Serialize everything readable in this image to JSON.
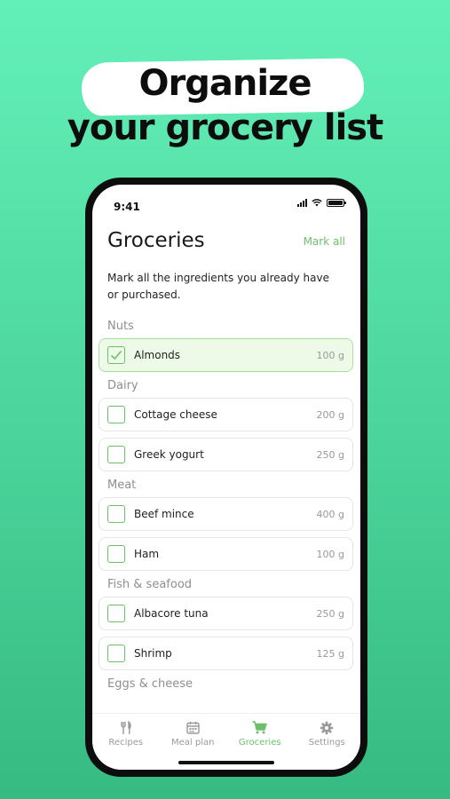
{
  "headline": {
    "line1": "Organize",
    "line2": "your grocery list"
  },
  "status_bar": {
    "time": "9:41"
  },
  "header": {
    "title": "Groceries",
    "mark_all": "Mark all"
  },
  "subtitle": "Mark all the ingredients you already have or purchased.",
  "sections": [
    {
      "title": "Nuts",
      "items": [
        {
          "name": "Almonds",
          "qty": "100 g",
          "checked": true
        }
      ]
    },
    {
      "title": "Dairy",
      "items": [
        {
          "name": "Cottage cheese",
          "qty": "200 g",
          "checked": false
        },
        {
          "name": "Greek yogurt",
          "qty": "250 g",
          "checked": false
        }
      ]
    },
    {
      "title": "Meat",
      "items": [
        {
          "name": "Beef mince",
          "qty": "400 g",
          "checked": false
        },
        {
          "name": "Ham",
          "qty": "100 g",
          "checked": false
        }
      ]
    },
    {
      "title": "Fish & seafood",
      "items": [
        {
          "name": "Albacore tuna",
          "qty": "250 g",
          "checked": false
        },
        {
          "name": "Shrimp",
          "qty": "125 g",
          "checked": false
        }
      ]
    },
    {
      "title": "Eggs & cheese",
      "items": []
    }
  ],
  "tabs": [
    {
      "label": "Recipes",
      "icon": "fork-knife-icon",
      "active": false
    },
    {
      "label": "Meal plan",
      "icon": "calendar-icon",
      "active": false
    },
    {
      "label": "Groceries",
      "icon": "cart-icon",
      "active": true
    },
    {
      "label": "Settings",
      "icon": "gear-icon",
      "active": false
    }
  ],
  "colors": {
    "accent": "#6cc06a",
    "checked_bg": "#edfae8",
    "background_top": "#63f0b8",
    "background_bottom": "#36bb82"
  }
}
